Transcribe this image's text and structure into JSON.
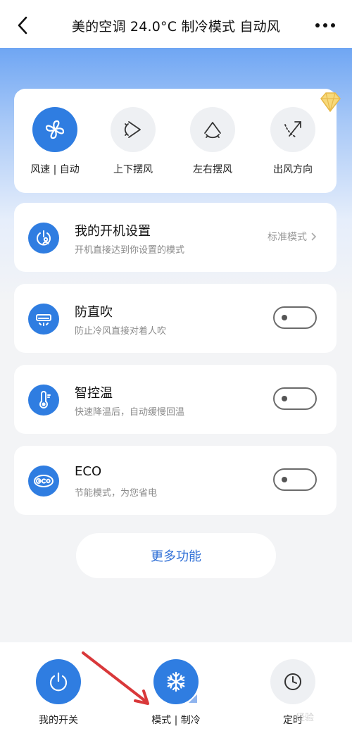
{
  "header": {
    "title": "美的空调 24.0°C 制冷模式 自动风",
    "back_icon": "chevron-left-icon",
    "more_icon": "more-dots-icon"
  },
  "fan_controls": [
    {
      "label": "风速 | 自动",
      "icon": "fan-icon",
      "active": true
    },
    {
      "label": "上下摆风",
      "icon": "vertical-swing-icon",
      "active": false
    },
    {
      "label": "左右摆风",
      "icon": "horizontal-swing-icon",
      "active": false
    },
    {
      "label": "出风方向",
      "icon": "airflow-direction-icon",
      "active": false
    }
  ],
  "settings": {
    "startup": {
      "title": "我的开机设置",
      "subtitle": "开机直接达到你设置的模式",
      "value": "标准模式"
    },
    "anti_direct": {
      "title": "防直吹",
      "subtitle": "防止冷风直接对着人吹",
      "enabled": false
    },
    "smart_temp": {
      "title": "智控温",
      "subtitle": "快速降温后，自动缓慢回温",
      "enabled": false
    },
    "eco": {
      "title": "ECO",
      "subtitle": "节能模式，为您省电",
      "enabled": false
    }
  },
  "more_functions_label": "更多功能",
  "bottom": {
    "power_label": "我的开关",
    "mode_label": "模式 | 制冷",
    "timer_label": "定时"
  },
  "watermark": "经验",
  "colors": {
    "accent": "#2f7de1",
    "link": "#2f6fd6",
    "annotation_arrow": "#d9383a"
  }
}
